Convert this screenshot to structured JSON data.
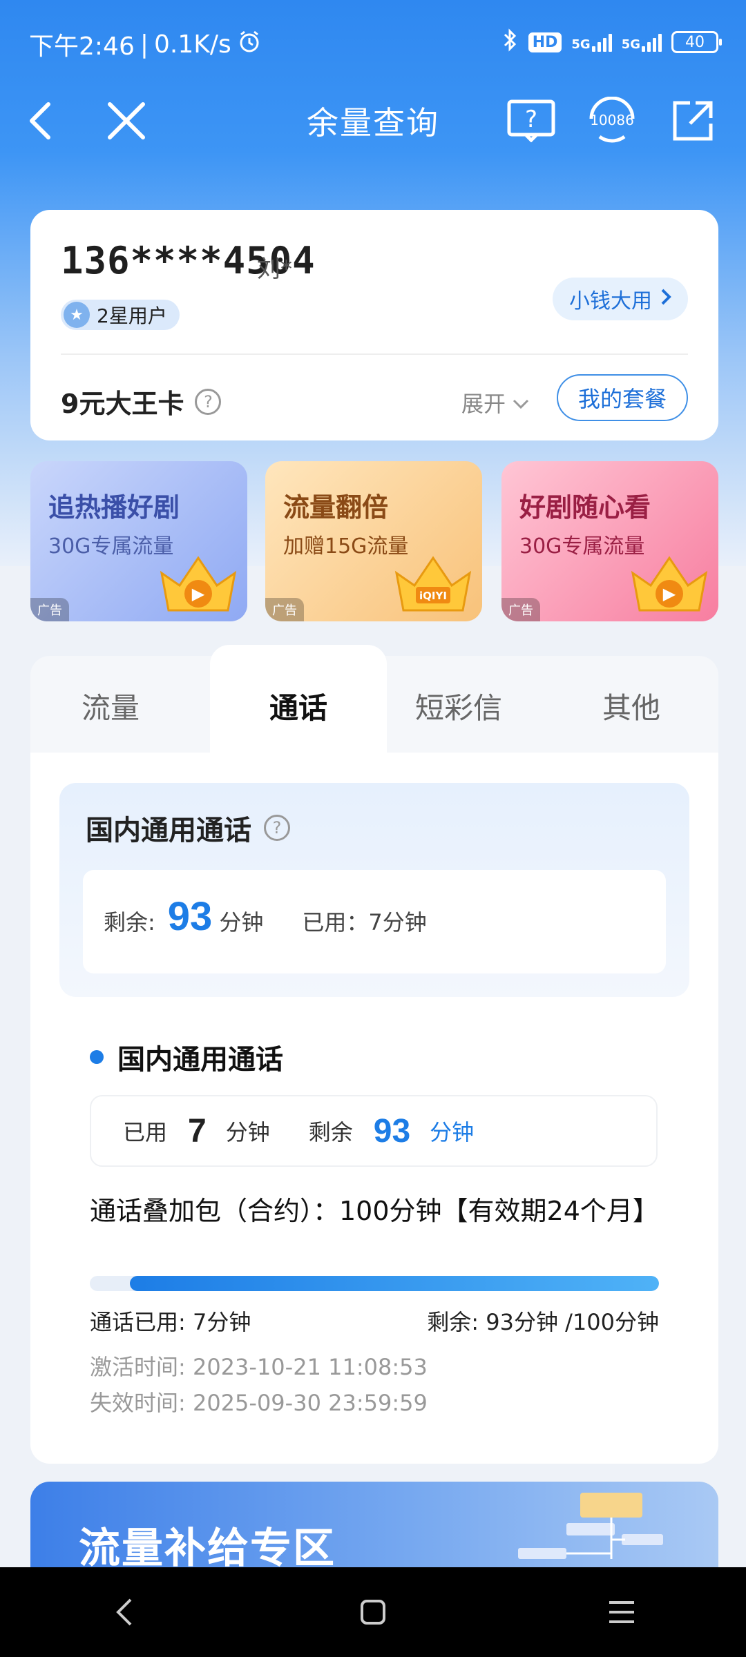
{
  "status_bar": {
    "time": "下午2:46",
    "speed": "0.1K/s",
    "hd_label": "HD",
    "network_1": "5G",
    "network_2": "5G",
    "battery": "40"
  },
  "nav": {
    "title": "余量查询",
    "service_number": "10086"
  },
  "account": {
    "phone": "136****4504",
    "name": "刘*",
    "star_level": "2星用户",
    "small_money_label": "小钱大用",
    "plan_name": "9元大王卡",
    "expand_label": "展开",
    "my_plan_button": "我的套餐"
  },
  "promos": [
    {
      "title": "追热播好剧",
      "subtitle": "30G专属流量",
      "ad": "广告",
      "crown_logo": "▶"
    },
    {
      "title": "流量翻倍",
      "subtitle": "加赠15G流量",
      "ad": "广告",
      "crown_logo": "iQIYI"
    },
    {
      "title": "好剧随心看",
      "subtitle": "30G专属流量",
      "ad": "广告",
      "crown_logo": "▶"
    }
  ],
  "tabs": [
    {
      "label": "流量"
    },
    {
      "label": "通话"
    },
    {
      "label": "短彩信"
    },
    {
      "label": "其他"
    }
  ],
  "active_tab": "通话",
  "summary": {
    "title": "国内通用通话",
    "remaining_label": "剩余:",
    "remaining_value": "93",
    "remaining_unit": "分钟",
    "used_text": "已用：7分钟"
  },
  "detail": {
    "title": "国内通用通话",
    "used_label": "已用",
    "used_value": "7",
    "used_unit": "分钟",
    "remaining_label": "剩余",
    "remaining_value": "93",
    "remaining_unit": "分钟",
    "package_desc": "通话叠加包（合约）：100分钟【有效期24个月】",
    "progress_remaining_fraction": 0.93,
    "used_text": "通话已用: 7分钟",
    "remaining_text": "剩余: 93分钟 /100分钟",
    "activation": "激活时间: 2023-10-21 11:08:53",
    "expiry": "失效时间: 2025-09-30 23:59:59"
  },
  "bottom_banner": {
    "title": "流量补给专区"
  },
  "colors": {
    "primary_blue": "#1d7de6",
    "header_blue": "#2f88f0"
  }
}
